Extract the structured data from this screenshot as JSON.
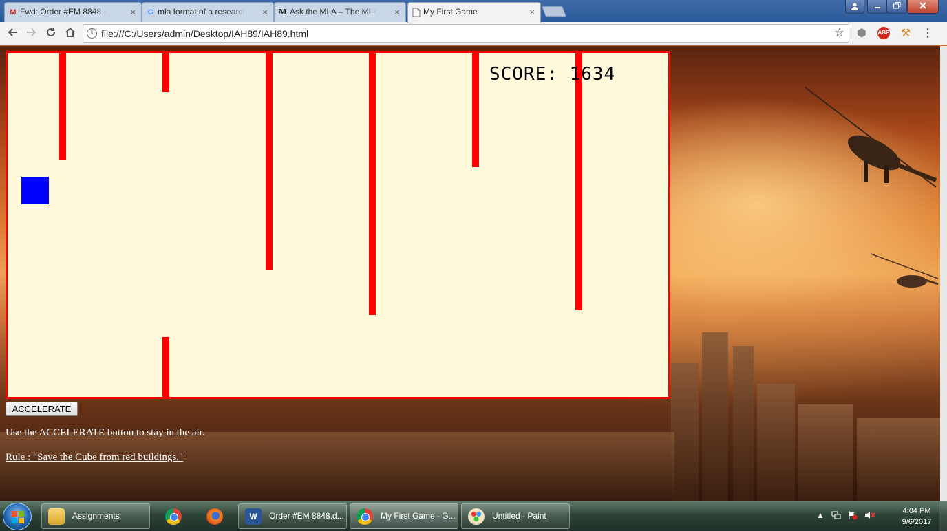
{
  "browser": {
    "tabs": [
      {
        "title": "Fwd: Order #EM 8848 - h",
        "favicon": "M",
        "favicon_color": "#d93025",
        "active": false
      },
      {
        "title": "mla format of a research",
        "favicon": "G",
        "favicon_color": "#4285f4",
        "active": false
      },
      {
        "title": "Ask the MLA – The MLA",
        "favicon": "M",
        "favicon_color": "#222222",
        "active": false
      },
      {
        "title": "My First Game",
        "favicon": "page-icon",
        "favicon_color": "#777777",
        "active": true
      }
    ],
    "close_glyph": "×",
    "url": "file:///C:/Users/admin/Desktop/IAH89/IAH89.html",
    "extensions": [
      "shield-icon",
      "ABP",
      "tool-icon",
      "menu-icon"
    ],
    "abp_label": "ABP"
  },
  "game": {
    "score_label": "SCORE: 1634",
    "score": 1634,
    "obstacle_color": "#ff0000",
    "player_color": "#0000ff",
    "background": "#fffadc",
    "accelerate_label": "ACCELERATE",
    "instructions": "Use the ACCELERATE button to stay in the air.",
    "rule": "Rule : \"Save the Cube from red buildings.\""
  },
  "taskbar": {
    "items": [
      {
        "label": "Assignments",
        "icon": "folder-icon"
      },
      {
        "label": "",
        "icon": "chrome-icon"
      },
      {
        "label": "",
        "icon": "firefox-icon"
      },
      {
        "label": "Order #EM 8848.d...",
        "icon": "word-icon"
      },
      {
        "label": "My First Game - G...",
        "icon": "chrome-icon"
      },
      {
        "label": "Untitled - Paint",
        "icon": "paint-icon"
      }
    ],
    "time": "4:04 PM",
    "date": "9/6/2017"
  }
}
